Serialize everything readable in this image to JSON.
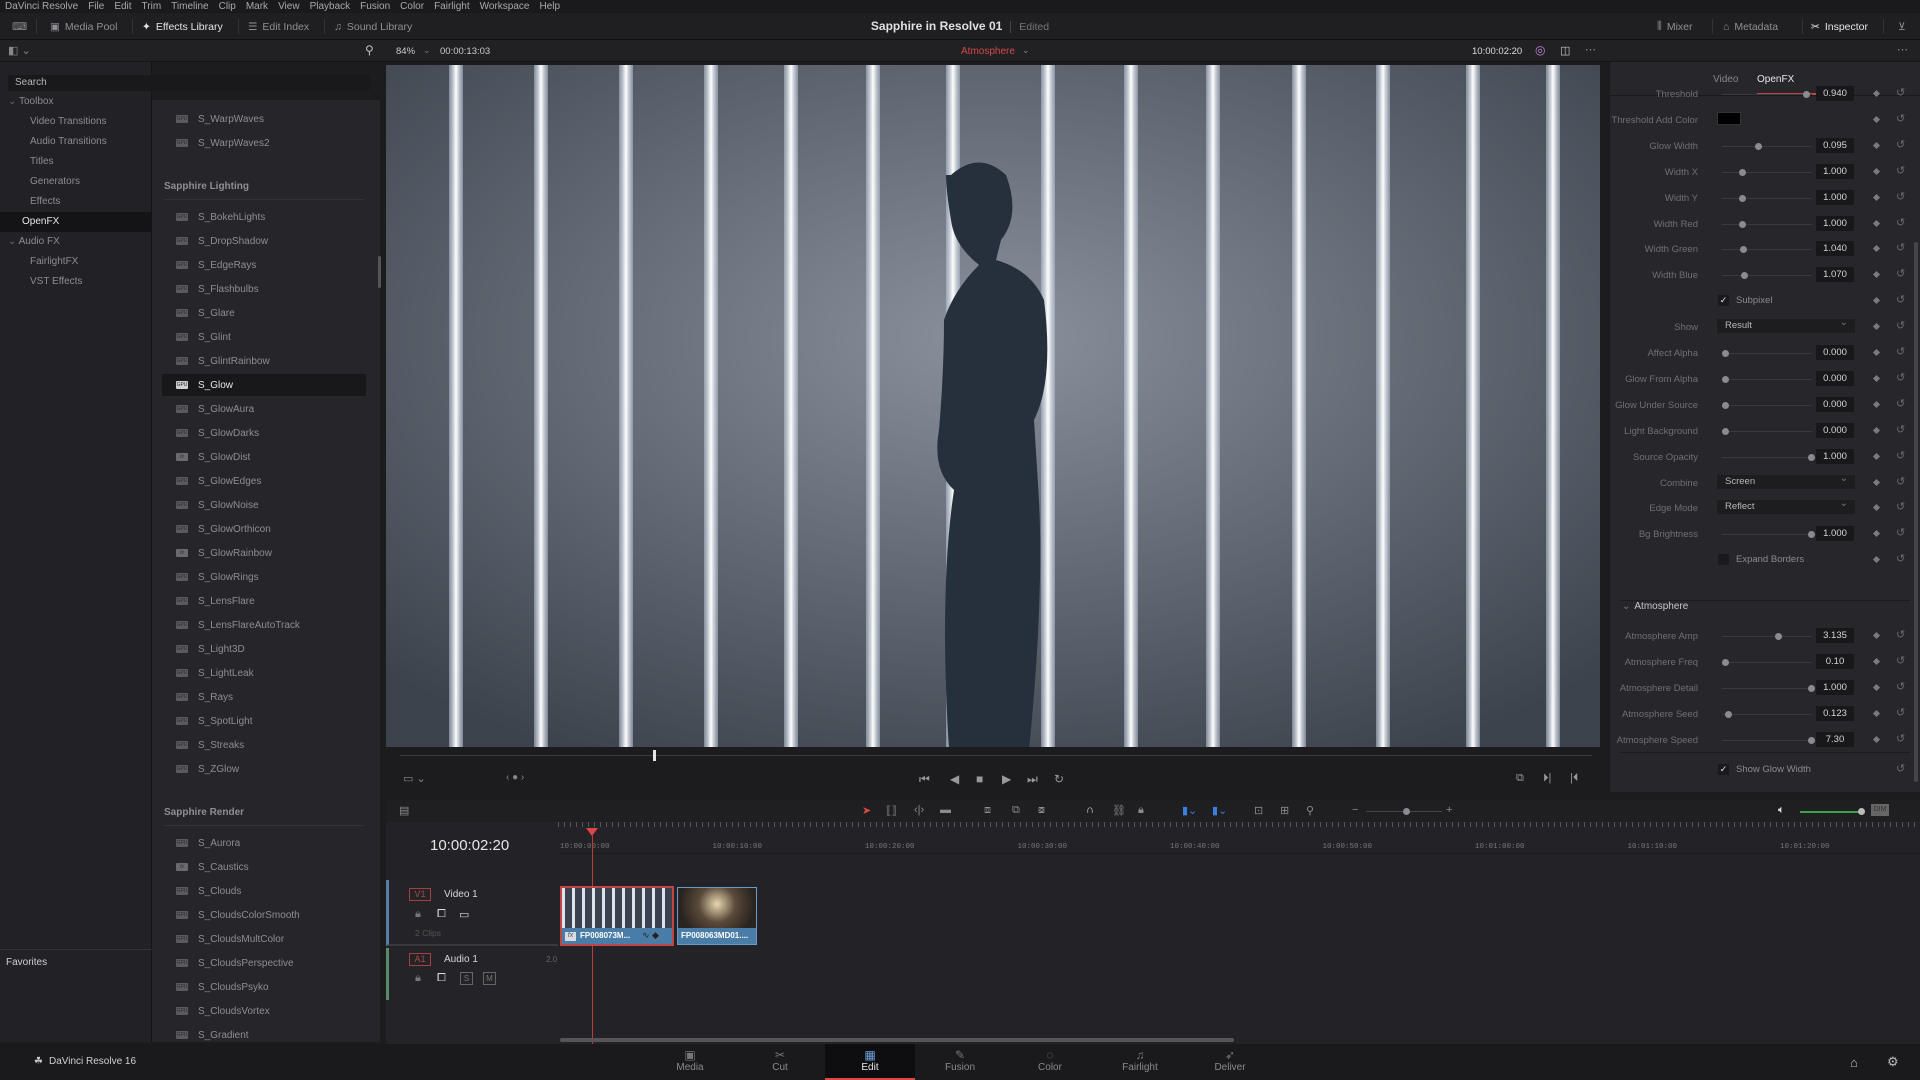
{
  "menu": [
    "DaVinci Resolve",
    "File",
    "Edit",
    "Trim",
    "Timeline",
    "Clip",
    "Mark",
    "View",
    "Playback",
    "Fusion",
    "Color",
    "Fairlight",
    "Workspace",
    "Help"
  ],
  "toolbar": {
    "media_pool": "Media Pool",
    "effects_library": "Effects Library",
    "edit_index": "Edit Index",
    "sound_library": "Sound Library",
    "mixer": "Mixer",
    "metadata": "Metadata",
    "inspector": "Inspector"
  },
  "project": {
    "title": "Sapphire in Resolve 01",
    "status": "Edited"
  },
  "viewer": {
    "zoom": "84%",
    "duration": "00:00:13:03",
    "clip_name": "Atmosphere",
    "timecode": "10:00:02:20",
    "playhead_position": 0.21
  },
  "library": {
    "search_placeholder": "Search",
    "tree": [
      {
        "label": "Toolbox",
        "level": 0,
        "expanded": true
      },
      {
        "label": "Video Transitions",
        "level": 1
      },
      {
        "label": "Audio Transitions",
        "level": 1
      },
      {
        "label": "Titles",
        "level": 1
      },
      {
        "label": "Generators",
        "level": 1
      },
      {
        "label": "Effects",
        "level": 1
      },
      {
        "label": "OpenFX",
        "level": 0,
        "selected": true
      },
      {
        "label": "Audio FX",
        "level": 0,
        "expanded": true
      },
      {
        "label": "FairlightFX",
        "level": 1
      },
      {
        "label": "VST Effects",
        "level": 1
      }
    ],
    "favorites_label": "Favorites",
    "groups": [
      {
        "name": "",
        "items": [
          {
            "label": "S_WarpWaves",
            "type": "gpu"
          },
          {
            "label": "S_WarpWaves2",
            "type": "gpu"
          }
        ]
      },
      {
        "name": "Sapphire Lighting",
        "items": [
          {
            "label": "S_BokehLights",
            "type": "gpu"
          },
          {
            "label": "S_DropShadow",
            "type": "gpu"
          },
          {
            "label": "S_EdgeRays",
            "type": "gpu"
          },
          {
            "label": "S_Flashbulbs",
            "type": "gpu"
          },
          {
            "label": "S_Glare",
            "type": "gpu"
          },
          {
            "label": "S_Glint",
            "type": "gpu"
          },
          {
            "label": "S_GlintRainbow",
            "type": "gpu"
          },
          {
            "label": "S_Glow",
            "type": "gpu",
            "selected": true
          },
          {
            "label": "S_GlowAura",
            "type": "gpu"
          },
          {
            "label": "S_GlowDarks",
            "type": "gpu"
          },
          {
            "label": "S_GlowDist",
            "type": "fx"
          },
          {
            "label": "S_GlowEdges",
            "type": "gpu"
          },
          {
            "label": "S_GlowNoise",
            "type": "gpu"
          },
          {
            "label": "S_GlowOrthicon",
            "type": "gpu"
          },
          {
            "label": "S_GlowRainbow",
            "type": "fx"
          },
          {
            "label": "S_GlowRings",
            "type": "gpu"
          },
          {
            "label": "S_LensFlare",
            "type": "gpu"
          },
          {
            "label": "S_LensFlareAutoTrack",
            "type": "gpu"
          },
          {
            "label": "S_Light3D",
            "type": "gpu"
          },
          {
            "label": "S_LightLeak",
            "type": "gpu"
          },
          {
            "label": "S_Rays",
            "type": "gpu"
          },
          {
            "label": "S_SpotLight",
            "type": "gpu"
          },
          {
            "label": "S_Streaks",
            "type": "gpu"
          },
          {
            "label": "S_ZGlow",
            "type": "gpu"
          }
        ]
      },
      {
        "name": "Sapphire Render",
        "items": [
          {
            "label": "S_Aurora",
            "type": "gpu"
          },
          {
            "label": "S_Caustics",
            "type": "fx"
          },
          {
            "label": "S_Clouds",
            "type": "gpu"
          },
          {
            "label": "S_CloudsColorSmooth",
            "type": "gpu"
          },
          {
            "label": "S_CloudsMultColor",
            "type": "gpu"
          },
          {
            "label": "S_CloudsPerspective",
            "type": "gpu"
          },
          {
            "label": "S_CloudsPsyko",
            "type": "gpu"
          },
          {
            "label": "S_CloudsVortex",
            "type": "gpu"
          },
          {
            "label": "S_Gradient",
            "type": "gpu"
          }
        ]
      }
    ]
  },
  "inspector": {
    "tabs": [
      {
        "label": "Video"
      },
      {
        "label": "OpenFX",
        "active": true
      }
    ],
    "params": [
      {
        "label": "Threshold",
        "kind": "slider",
        "value": "0.940",
        "pos": 0.94
      },
      {
        "label": "Threshold Add Color",
        "kind": "color",
        "color": "#000000"
      },
      {
        "label": "Glow Width",
        "kind": "slider",
        "value": "0.095",
        "pos": 0.38
      },
      {
        "label": "Width X",
        "kind": "slider",
        "value": "1.000",
        "pos": 0.2
      },
      {
        "label": "Width Y",
        "kind": "slider",
        "value": "1.000",
        "pos": 0.2
      },
      {
        "label": "Width Red",
        "kind": "slider",
        "value": "1.000",
        "pos": 0.2
      },
      {
        "label": "Width Green",
        "kind": "slider",
        "value": "1.040",
        "pos": 0.21
      },
      {
        "label": "Width Blue",
        "kind": "slider",
        "value": "1.070",
        "pos": 0.22
      },
      {
        "label": "Subpixel",
        "kind": "checkbox",
        "checked": true
      },
      {
        "label": "Show",
        "kind": "dropdown",
        "value": "Result"
      },
      {
        "label": "Affect Alpha",
        "kind": "slider",
        "value": "0.000",
        "pos": 0
      },
      {
        "label": "Glow From Alpha",
        "kind": "slider",
        "value": "0.000",
        "pos": 0
      },
      {
        "label": "Glow Under Source",
        "kind": "slider",
        "value": "0.000",
        "pos": 0
      },
      {
        "label": "Light Background",
        "kind": "slider",
        "value": "0.000",
        "pos": 0
      },
      {
        "label": "Source Opacity",
        "kind": "slider",
        "value": "1.000",
        "pos": 1
      },
      {
        "label": "Combine",
        "kind": "dropdown",
        "value": "Screen"
      },
      {
        "label": "Edge Mode",
        "kind": "dropdown",
        "value": "Reflect"
      },
      {
        "label": "Bg Brightness",
        "kind": "slider",
        "value": "1.000",
        "pos": 1
      },
      {
        "label": "Expand Borders",
        "kind": "checkbox",
        "checked": false
      }
    ],
    "atmosphere_section": "Atmosphere",
    "atmosphere_params": [
      {
        "label": "Atmosphere Amp",
        "kind": "slider",
        "value": "3.135",
        "pos": 0.62
      },
      {
        "label": "Atmosphere Freq",
        "kind": "slider",
        "value": "0.10",
        "pos": 0
      },
      {
        "label": "Atmosphere Detail",
        "kind": "slider",
        "value": "1.000",
        "pos": 1
      },
      {
        "label": "Atmosphere Seed",
        "kind": "slider",
        "value": "0.123",
        "pos": 0.03
      },
      {
        "label": "Atmosphere Speed",
        "kind": "slider",
        "value": "7.30",
        "pos": 1
      }
    ],
    "show_glow_width": {
      "label": "Show Glow Width",
      "checked": true
    }
  },
  "timeline": {
    "timecode": "10:00:02:20",
    "ruler": [
      "10:00:00:00",
      "10:00:10:00",
      "10:00:20:00",
      "10:00:30:00",
      "10:00:40:00",
      "10:00:50:00",
      "10:01:00:00",
      "10:01:10:00",
      "10:01:20:00"
    ],
    "tracks": [
      {
        "id": "V1",
        "name": "Video 1",
        "info": "2 Clips"
      },
      {
        "id": "A1",
        "name": "Audio 1",
        "info": "2.0"
      }
    ],
    "clips": [
      {
        "label": "FP008073M...",
        "selected": true,
        "has_fx": true
      },
      {
        "label": "FP008063MD01....",
        "selected": false
      }
    ],
    "audio_buttons": [
      "S",
      "M"
    ],
    "volume": 1.0,
    "dim_label": "DIM"
  },
  "footer": {
    "app": "DaVinci Resolve 16",
    "pages": [
      {
        "label": "Media",
        "icon": "media-icon"
      },
      {
        "label": "Cut",
        "icon": "cut-icon"
      },
      {
        "label": "Edit",
        "icon": "edit-icon",
        "active": true
      },
      {
        "label": "Fusion",
        "icon": "fusion-icon"
      },
      {
        "label": "Color",
        "icon": "color-icon"
      },
      {
        "label": "Fairlight",
        "icon": "fairlight-icon"
      },
      {
        "label": "Deliver",
        "icon": "deliver-icon"
      }
    ]
  },
  "colors": {
    "accent": "#e04646",
    "clip_blue": "#4a7ca8",
    "audio_green": "#3fa34a"
  }
}
